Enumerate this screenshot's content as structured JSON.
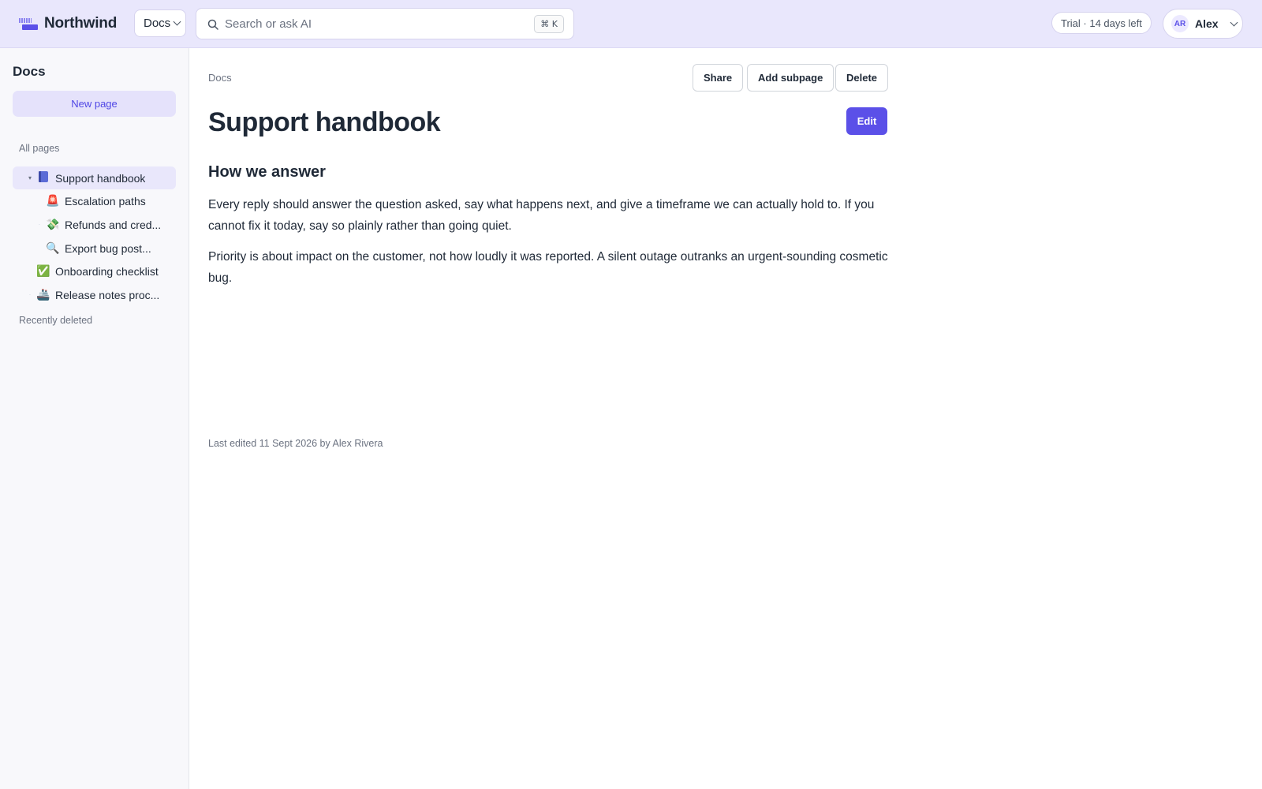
{
  "app": {
    "name": "Northwind",
    "space": "Docs",
    "search": {
      "placeholder": "Search or ask AI",
      "shortcut": "⌘ K"
    },
    "trial": "Trial · 14 days left",
    "user": {
      "initials": "AR",
      "name": "Alex"
    },
    "colors": {
      "accent": "#5b50e8",
      "topbar": "#e9e7fc",
      "sidebar": "#f8f8fb"
    }
  },
  "sidebar": {
    "title": "Docs",
    "new_page": "New page",
    "all_pages": "All pages",
    "recently_deleted": "Recently deleted",
    "items": [
      {
        "label": "Support handbook",
        "icon": "book-icon",
        "glyph": ""
      },
      {
        "label": "Escalation paths",
        "icon": "siren-icon",
        "glyph": "🚨"
      },
      {
        "label": "Refunds and cred...",
        "icon": "money-wings-icon",
        "glyph": "💸"
      },
      {
        "label": "Export bug post...",
        "icon": "magnifier-icon",
        "glyph": "🔍"
      },
      {
        "label": "Onboarding checklist",
        "icon": "check-mark-icon",
        "glyph": "✅"
      },
      {
        "label": "Release notes proc...",
        "icon": "ship-icon",
        "glyph": "🚢"
      }
    ]
  },
  "main": {
    "breadcrumb": "Docs",
    "actions": {
      "share": "Share",
      "add_subpage": "Add subpage",
      "delete": "Delete",
      "edit": "Edit"
    },
    "title": "Support handbook",
    "heading": "How we answer",
    "paragraphs": [
      "Every reply should answer the question asked, say what happens next, and give a timeframe we can actually hold to. If you cannot fix it today, say so plainly rather than going quiet.",
      "Priority is about impact on the customer, not how loudly it was reported. A silent outage outranks an urgent-sounding cosmetic bug."
    ],
    "last_edited": "Last edited 11 Sept 2026 by Alex Rivera"
  }
}
